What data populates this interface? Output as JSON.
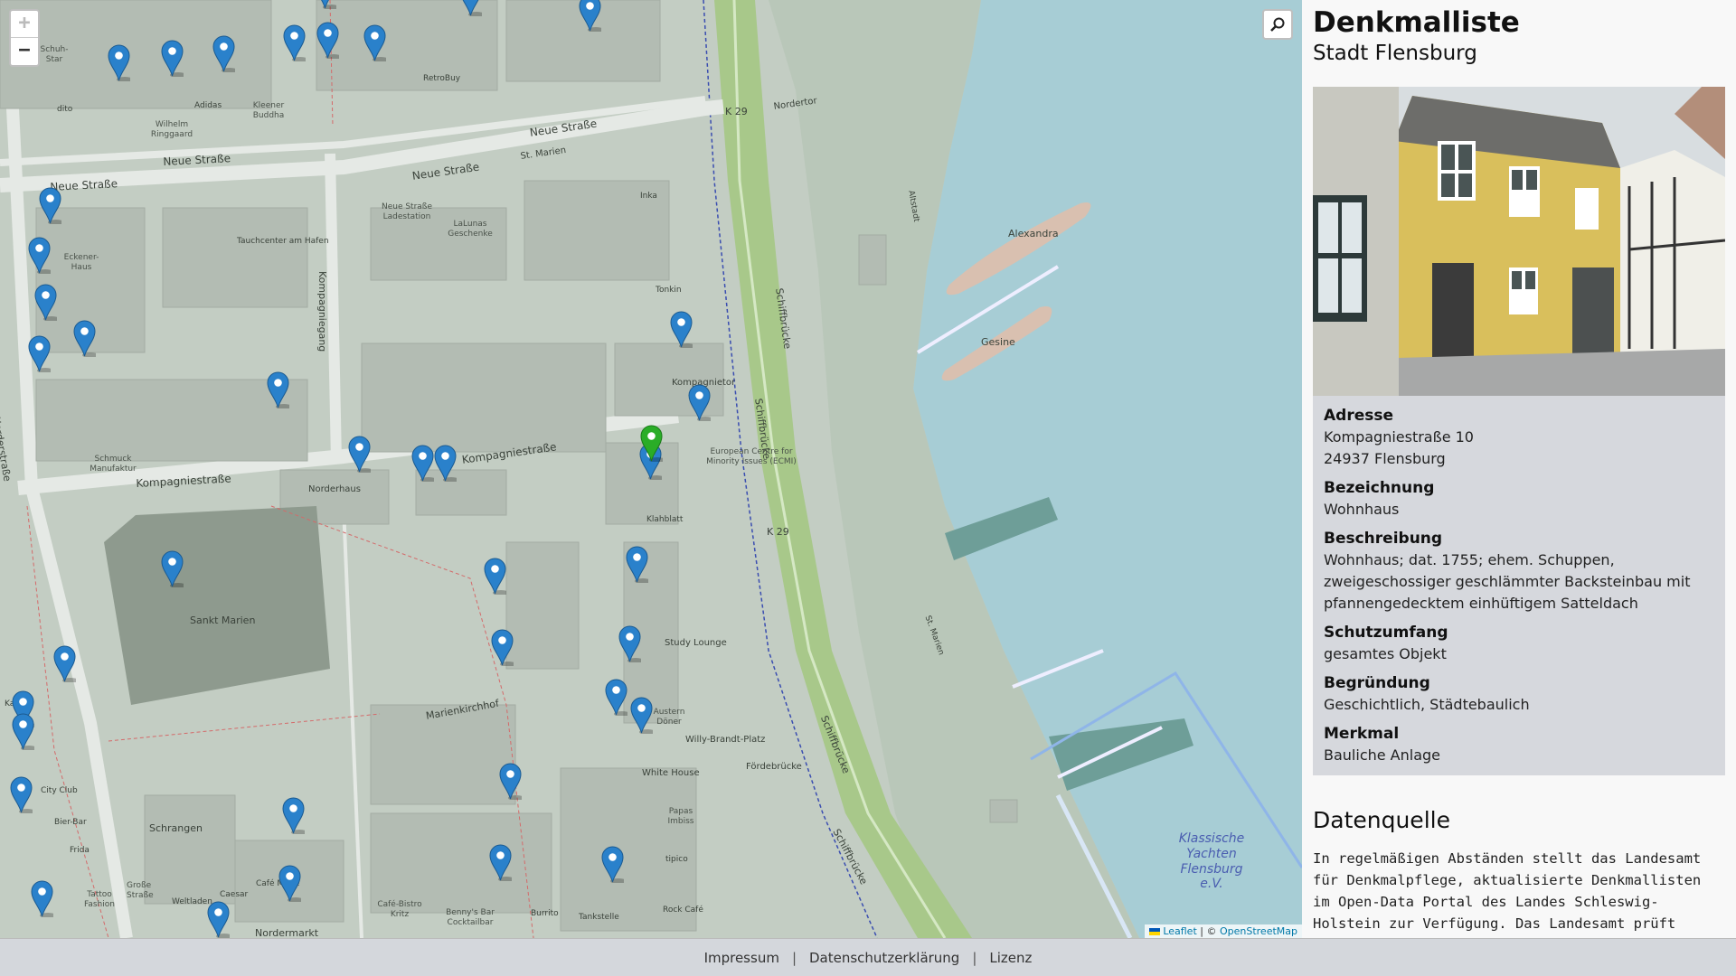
{
  "map": {
    "zoom_in": "+",
    "zoom_out": "−",
    "attribution_leaflet": "Leaflet",
    "attribution_osm": "OpenStreetMap",
    "attribution_sep": "| ©",
    "labels": {
      "neue_strasse_1": "Neue Straße",
      "neue_strasse_2": "Neue Straße",
      "neue_strasse_3": "Neue Straße",
      "neue_strasse_4": "Neue Straße",
      "kompagniestrasse_1": "Kompagniestraße",
      "kompagniestrasse_2": "Kompagniestraße",
      "kompagniegang": "Kompagniegang",
      "norderstrasse": "Norderstraße",
      "schiffbruecke_1": "Schiffbrücke",
      "schiffbruecke_2": "Schiffbrücke",
      "schiffbruecke_3": "Schiffbrücke",
      "schiffbruecke_4": "Schiffbrücke",
      "k29_1": "K 29",
      "k29_2": "K 29",
      "marienkirchhof": "Marienkirchhof",
      "sankt_marien": "Sankt Marien",
      "norderhaus": "Norderhaus",
      "kompagnietor": "Kompagnietor",
      "ecmi": "European Centre for Minority Issues (ECMI)",
      "willy_brandt": "Willy-Brandt-Platz",
      "foerdebruecke": "Fördebrücke",
      "alexandra": "Alexandra",
      "gesine": "Gesine",
      "klassische": "Klassische Yachten Flensburg e.V.",
      "nordermarkt": "Nordermarkt",
      "schrangen": "Schrangen",
      "grosse_strasse": "Große Straße",
      "study_lounge": "Study Lounge",
      "white_house": "White House",
      "papas_imbiss": "Papas Imbiss",
      "tipico": "tipico",
      "rock_cafe": "Rock Café",
      "tankstelle": "Tankstelle",
      "burrito": "Burrito",
      "bennys": "Benny's Bar Cocktailbar",
      "cafe_bistro": "Café-Bistro Kritz",
      "weltladen": "Weltladen",
      "caesar": "Caesar",
      "cafe_marie": "Café Marie",
      "tattoo": "Tattoo Fashion",
      "frida": "Frida",
      "bier_bar": "Bier-Bar",
      "city_club": "City Club",
      "schmuck": "Schmuck Manufaktur",
      "tauchcenter": "Tauchcenter am Hafen",
      "eckener": "Eckener-Haus",
      "neue_strasse_ladestation": "Neue Straße Ladestation",
      "lalunas": "LaLunas Geschenke",
      "inka": "Inka",
      "tonkin": "Tonkin",
      "retrobuy": "RetroBuy",
      "kleener_buddha": "Kleener Buddha",
      "wilhelm": "Wilhelm Ringgaard",
      "adidas": "Adidas",
      "dito": "dito",
      "schuh_star": "Schuh-Star",
      "st_marien": "St. Marien",
      "norderfor": "Nordertor",
      "altstadt": "Altstadt",
      "st_marien_2": "St. Marien",
      "kabuis": "Kabuis",
      "klahblatt": "Klahblatt",
      "austern": "Austern Döner"
    }
  },
  "panel": {
    "title": "Denkmalliste",
    "subtitle": "Stadt Flensburg",
    "fields": [
      {
        "label": "Adresse",
        "value_lines": [
          "Kompagniestraße 10",
          "24937 Flensburg"
        ]
      },
      {
        "label": "Bezeichnung",
        "value_lines": [
          "Wohnhaus"
        ]
      },
      {
        "label": "Beschreibung",
        "value_lines": [
          "Wohnhaus; dat. 1755; ehem. Schuppen,",
          "zweigeschossiger geschlämmter Backsteinbau mit",
          "pfannengedecktem einhüftigem Satteldach"
        ]
      },
      {
        "label": "Schutzumfang",
        "value_lines": [
          "gesamtes Objekt"
        ]
      },
      {
        "label": "Begründung",
        "value_lines": [
          "Geschichtlich, Städtebaulich"
        ]
      },
      {
        "label": "Merkmal",
        "value_lines": [
          "Bauliche Anlage"
        ]
      }
    ],
    "source_title": "Datenquelle",
    "source_lines": [
      "In regelmäßigen Abständen stellt das Landesamt",
      "für Denkmalpflege, aktualisierte Denkmallisten",
      "im Open-Data Portal des Landes Schleswig-",
      "Holstein zur Verfügung. Das Landesamt prüft"
    ]
  },
  "footer": {
    "links": [
      "Impressum",
      "Datenschutzerklärung",
      "Lizenz"
    ],
    "separator": "|"
  },
  "colors": {
    "water": "#aad3df",
    "marker_blue": "#2a81cb",
    "marker_green": "#2aad27",
    "road_green": "#a8c88a",
    "building": "#c9c9c1",
    "panel_details": "#d6d8dd"
  }
}
